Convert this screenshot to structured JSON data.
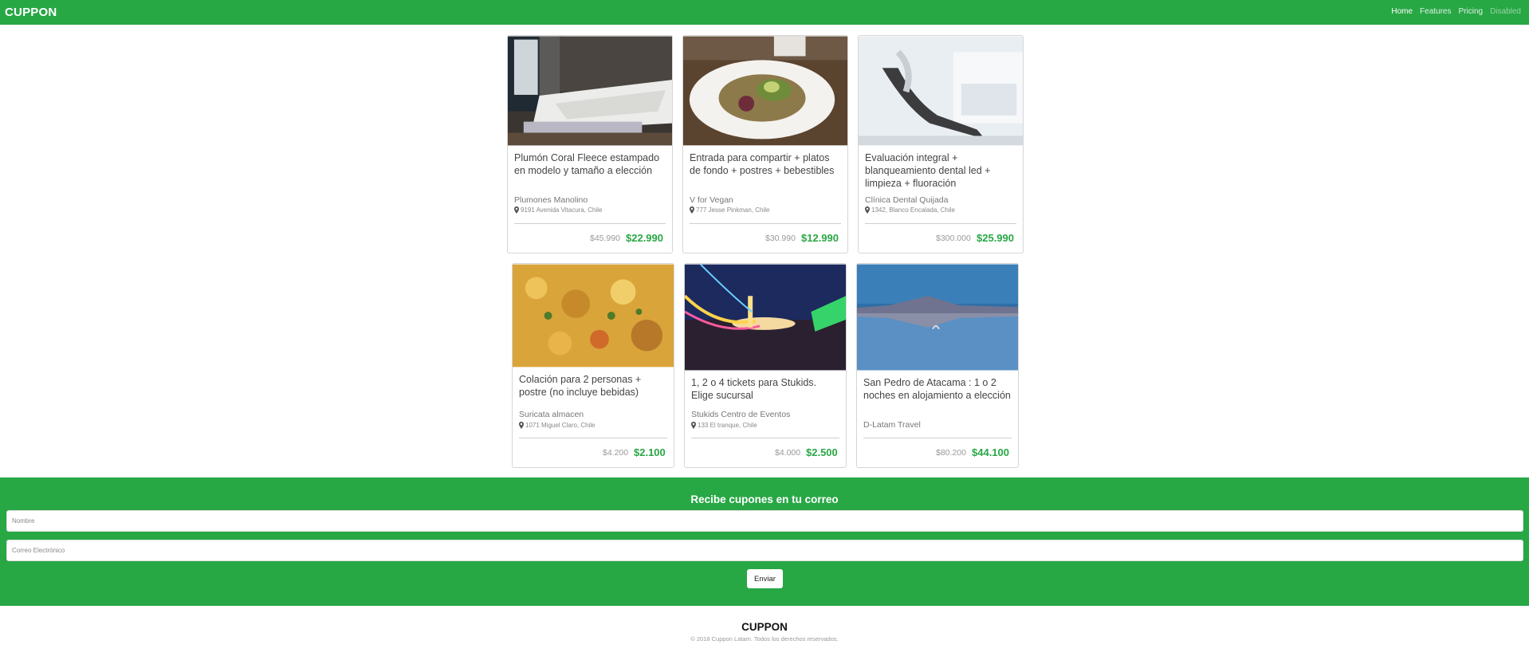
{
  "brand": "CUPPON",
  "nav": {
    "home": "Home",
    "features": "Features",
    "pricing": "Pricing",
    "disabled": "Disabled"
  },
  "deals": [
    {
      "title": "Plumón Coral Fleece estampado en modelo y tamaño a elección",
      "merchant": "Plumones Manolino",
      "address": "9191 Avenida Vitacura, Chile",
      "old_price": "$45.990",
      "new_price": "$22.990",
      "image": "bedroom-photo"
    },
    {
      "title": "Entrada para compartir + platos de fondo + postres + bebestibles",
      "merchant": "V for Vegan",
      "address": "777 Jesse Pinkman, Chile",
      "old_price": "$30.990",
      "new_price": "$12.990",
      "image": "salad-plate-photo"
    },
    {
      "title": "Evaluación integral + blanqueamiento dental led + limpieza + fluoración",
      "merchant": "Clínica Dental Quijada",
      "address": "1342, Blanco Encalada, Chile",
      "old_price": "$300.000",
      "new_price": "$25.990",
      "image": "dental-chair-photo"
    },
    {
      "title": "Colación para 2 personas + postre (no incluye bebidas)",
      "merchant": "Suricata almacen",
      "address": "1071 Miguel Claro, Chile",
      "old_price": "$4.200",
      "new_price": "$2.100",
      "image": "chickpea-stew-photo"
    },
    {
      "title": "1, 2 o 4 tickets para Stukids. Elige sucursal",
      "merchant": "Stukids Centro de Eventos",
      "address": "133 El tranque, Chile",
      "old_price": "$4.000",
      "new_price": "$2.500",
      "image": "fairground-night-photo"
    },
    {
      "title": "San Pedro de Atacama : 1 o 2 noches en alojamiento a elección",
      "merchant": "D-Latam Travel",
      "old_price": "$80.200",
      "new_price": "$44.100",
      "image": "salt-lake-flamingo-photo"
    }
  ],
  "newsletter": {
    "title": "Recibe cupones en tu correo",
    "name_placeholder": "Nombre",
    "email_placeholder": "Correo Electrónico",
    "submit_label": "Enviar"
  },
  "footer": {
    "brand": "CUPPON",
    "copyright": "© 2018 Cuppon Latam. Todos los derechos reservados."
  },
  "colors": {
    "brand_green": "#28a745",
    "price_green": "#28a745"
  },
  "icons": {
    "address": "map-marker-icon"
  }
}
